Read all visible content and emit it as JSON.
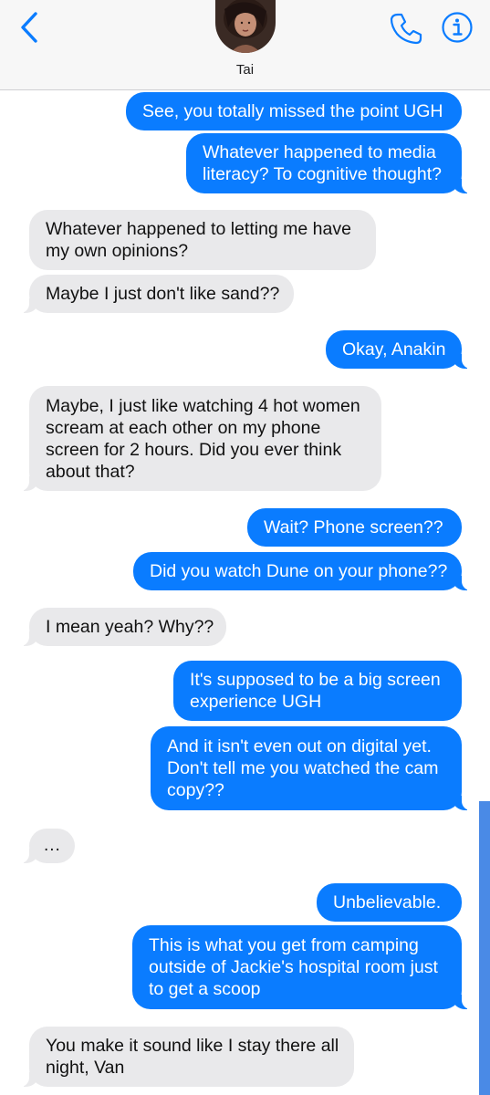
{
  "header": {
    "contact_name": "Tai",
    "back_icon": "chevron-left-icon",
    "call_icon": "phone-icon",
    "info_icon": "info-icon",
    "accent_color": "#0a7cff"
  },
  "messages": [
    {
      "direction": "outgoing",
      "text": "See, you totally missed the point UGH"
    },
    {
      "direction": "outgoing",
      "lines": [
        "Whatever happened to media",
        "literacy? To cognitive thought?"
      ]
    },
    {
      "direction": "incoming",
      "lines": [
        "Whatever happened to letting me have",
        "my own opinions?"
      ]
    },
    {
      "direction": "incoming",
      "text": "Maybe I just don't like sand??"
    },
    {
      "direction": "outgoing",
      "text": "Okay, Anakin"
    },
    {
      "direction": "incoming",
      "lines": [
        "Maybe, I just like watching 4 hot women",
        "scream at each other on my phone",
        "screen for 2 hours. Did you ever think",
        "about that?"
      ]
    },
    {
      "direction": "outgoing",
      "text": "Wait? Phone screen??"
    },
    {
      "direction": "outgoing",
      "text": "Did you watch Dune on your phone??"
    },
    {
      "direction": "incoming",
      "text": "I mean yeah? Why??"
    },
    {
      "direction": "outgoing",
      "lines": [
        "It's supposed to be a big screen",
        "experience UGH"
      ]
    },
    {
      "direction": "outgoing",
      "lines": [
        "And it isn't even out on digital yet.",
        "Don't tell me you watched the cam",
        "copy??"
      ]
    },
    {
      "direction": "incoming",
      "text": "..."
    },
    {
      "direction": "outgoing",
      "text": "Unbelievable."
    },
    {
      "direction": "outgoing",
      "lines": [
        "This is what you get from camping",
        "outside of Jackie's hospital room just",
        "to get a scoop"
      ]
    },
    {
      "direction": "incoming",
      "lines": [
        "You make it sound like I stay there all",
        "night, Van"
      ]
    }
  ]
}
